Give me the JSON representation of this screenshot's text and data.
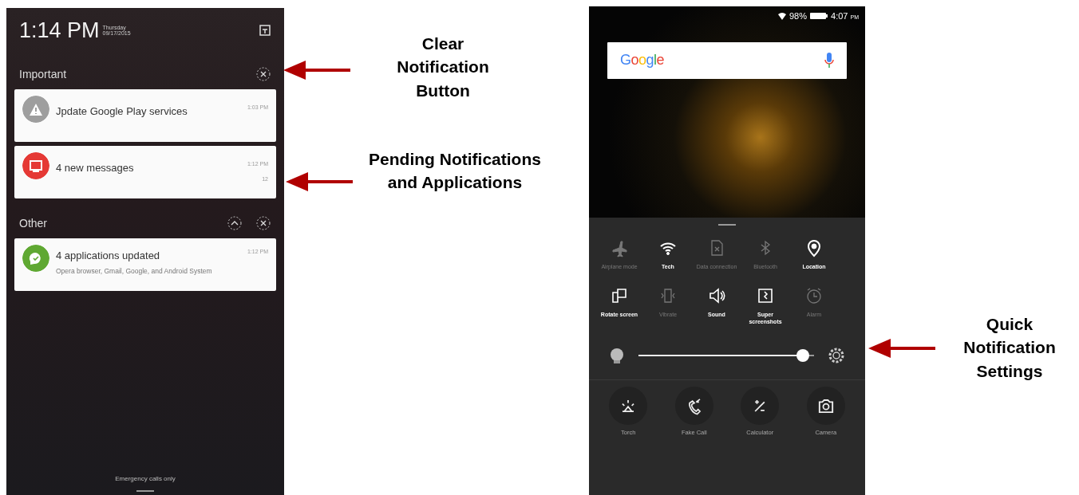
{
  "notification_screen": {
    "clock": "1:14 PM",
    "day": "Thursday",
    "date": "09/17/2015",
    "sections": [
      {
        "title": "Important",
        "notifications": [
          {
            "title": "Jpdate Google Play services",
            "time": "1:03 PM",
            "color": "#9e9e9e"
          },
          {
            "title": "4 new messages",
            "time": "1:12 PM",
            "count": "12",
            "color": "#e53935"
          }
        ]
      },
      {
        "title": "Other",
        "notifications": [
          {
            "title": "4 applications updated",
            "time": "1:12 PM",
            "detail": "Opera browser, Gmail, Google, and Android System",
            "color": "#5fa832"
          }
        ]
      }
    ],
    "footer": "Emergency calls only"
  },
  "quick_settings_screen": {
    "status": {
      "battery": "98%",
      "time": "4:07",
      "ampm": "PM"
    },
    "search": {
      "logo": "Google"
    },
    "toggles": [
      {
        "label": "Airplane mode",
        "on": false
      },
      {
        "label": "Tech",
        "on": true
      },
      {
        "label": "Data connection",
        "on": false
      },
      {
        "label": "Bluetooth",
        "on": false
      },
      {
        "label": "Location",
        "on": true
      },
      {
        "label": "Rotate screen",
        "on": true
      },
      {
        "label": "Vibrate",
        "on": false
      },
      {
        "label": "Sound",
        "on": true
      },
      {
        "label": "Super screenshots",
        "on": true
      },
      {
        "label": "Alarm",
        "on": false
      }
    ],
    "brightness": {
      "level": 0.97
    },
    "shortcuts": [
      {
        "label": "Torch"
      },
      {
        "label": "Fake Call"
      },
      {
        "label": "Calculator"
      },
      {
        "label": "Camera"
      }
    ]
  },
  "callouts": [
    {
      "text": "Clear Notification Button"
    },
    {
      "text": "Pending Notifications and Applications"
    },
    {
      "text": "Quick Notification Settings"
    }
  ]
}
